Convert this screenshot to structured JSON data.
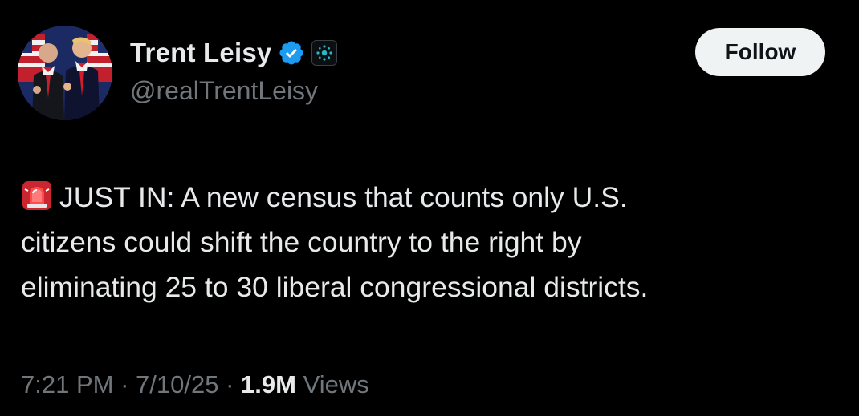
{
  "author": {
    "display_name": "Trent Leisy",
    "handle": "@realTrentLeisy",
    "verified_icon": "verified-badge-icon",
    "affiliate_icon": "affiliate-badge-icon",
    "avatar_icon": "profile-photo"
  },
  "actions": {
    "follow_label": "Follow"
  },
  "tweet": {
    "emoji_icon": "rotating-light-icon",
    "lines": [
      "JUST IN: A new census that counts only U.S.",
      "citizens could shift the country to the right by",
      "eliminating 25 to 30 liberal congressional districts."
    ]
  },
  "meta": {
    "time": "7:21 PM",
    "separator": "·",
    "date": "7/10/25",
    "views_count": "1.9M",
    "views_label": "Views"
  },
  "colors": {
    "background": "#000000",
    "primary_text": "#e7e9ea",
    "secondary_text": "#71767b",
    "verified_blue": "#1d9bf0",
    "follow_bg": "#eff3f4"
  }
}
